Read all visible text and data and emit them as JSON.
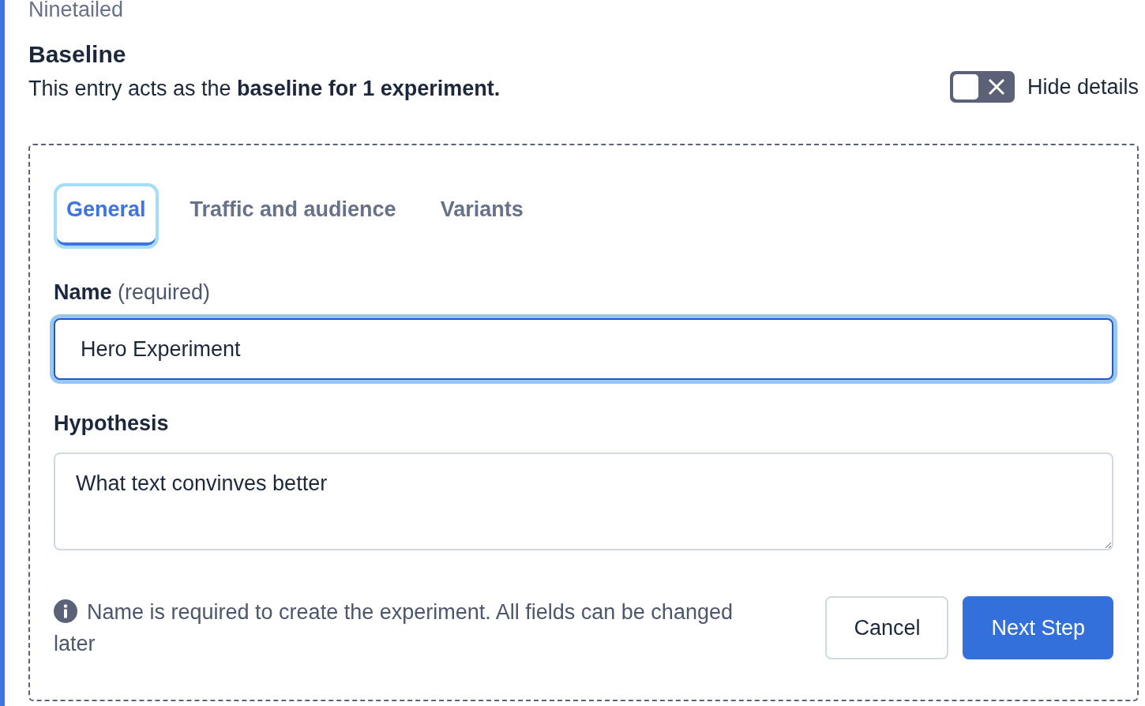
{
  "app_name": "Ninetailed",
  "baseline": {
    "title": "Baseline",
    "description": "This entry acts as the **baseline for 1 experiment.**"
  },
  "details_toggle": {
    "label": "Hide details",
    "on": false
  },
  "tabs": [
    {
      "label": "General",
      "selected": true
    },
    {
      "label": "Traffic and audience",
      "selected": false
    },
    {
      "label": "Variants",
      "selected": false
    }
  ],
  "name_field": {
    "label": "Name",
    "hint": "(required)",
    "value": "Hero Experiment",
    "focused": true
  },
  "hypothesis_field": {
    "label": "Hypothesis",
    "value": "What text convinves better"
  },
  "info_note": "Name is required to create the experiment. All fields can be changed later",
  "buttons": [
    {
      "label": "Cancel",
      "kind": "secondary"
    },
    {
      "label": "Next Step",
      "kind": "primary"
    }
  ]
}
